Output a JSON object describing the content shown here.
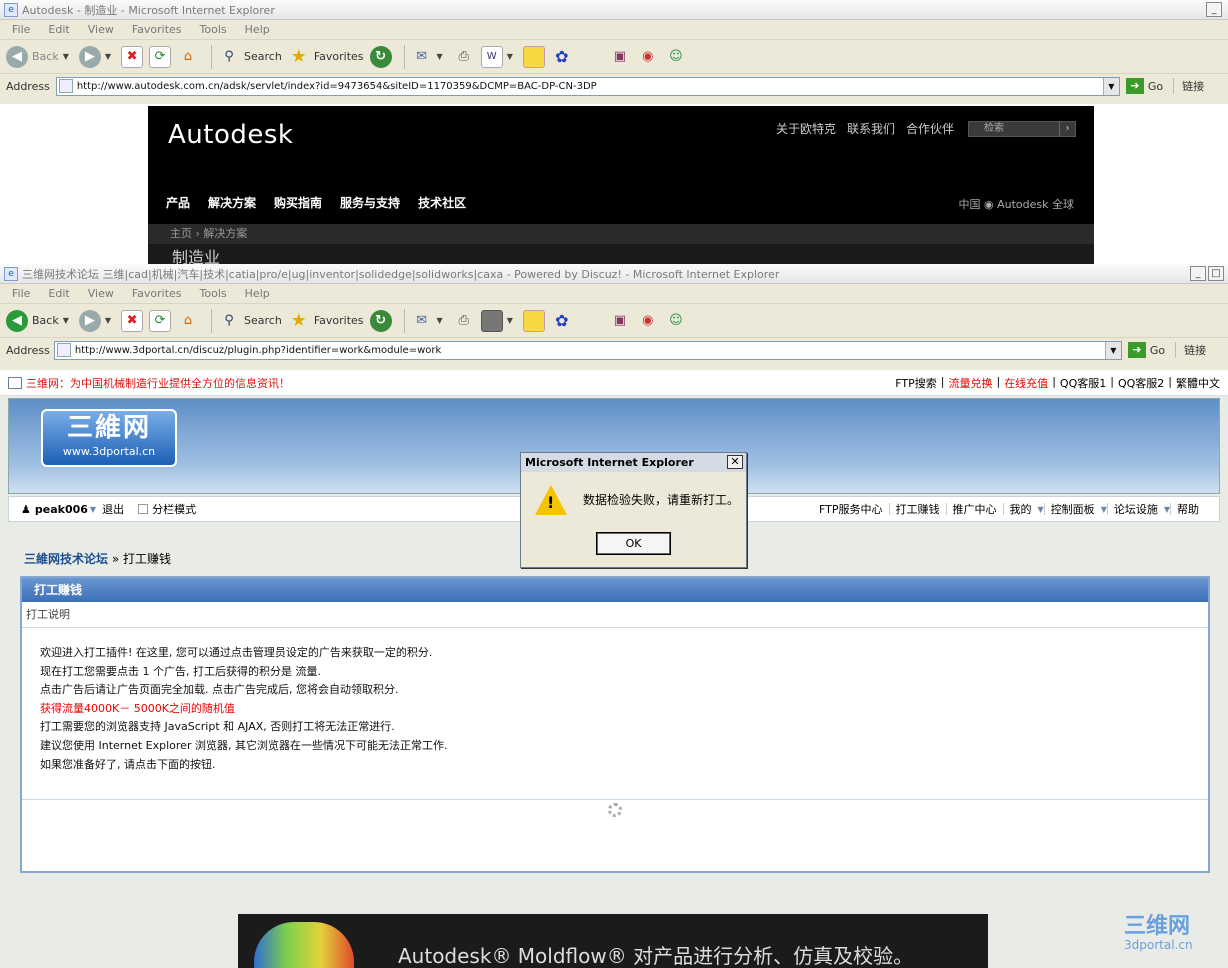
{
  "window1": {
    "title": "Autodesk - 制造业 - Microsoft Internet Explorer",
    "menu": [
      "File",
      "Edit",
      "View",
      "Favorites",
      "Tools",
      "Help"
    ],
    "toolbar": {
      "back": "Back",
      "search": "Search",
      "favorites": "Favorites"
    },
    "address_label": "Address",
    "url": "http://www.autodesk.com.cn/adsk/servlet/index?id=9473654&siteID=1170359&DCMP=BAC-DP-CN-3DP",
    "go": "Go",
    "links": "链接",
    "page": {
      "logo": "Autodesk",
      "top_links": [
        "关于欧特克",
        "联系我们",
        "合作伙伴"
      ],
      "search_placeholder": "检索",
      "nav": [
        "产品",
        "解决方案",
        "购买指南",
        "服务与支持",
        "技术社区"
      ],
      "region": "中国",
      "global": "Autodesk 全球",
      "breadcrumb": "主页 › 解决方案",
      "subtitle": "制造业"
    }
  },
  "window2": {
    "title": "三维网技术论坛 三维|cad|机械|汽车|技术|catia|pro/e|ug|inventor|solidedge|solidworks|caxa - Powered by Discuz! - Microsoft Internet Explorer",
    "menu": [
      "File",
      "Edit",
      "View",
      "Favorites",
      "Tools",
      "Help"
    ],
    "toolbar": {
      "back": "Back",
      "search": "Search",
      "favorites": "Favorites"
    },
    "address_label": "Address",
    "url": "http://www.3dportal.cn/discuz/plugin.php?identifier=work&module=work",
    "go": "Go",
    "links": "链接",
    "page": {
      "slogan": "三维网：为中国机械制造行业提供全方位的信息资讯！",
      "top_right": [
        "FTP搜索",
        "流量兑换",
        "在线充值",
        "QQ客服1",
        "QQ客服2",
        "繁體中文"
      ],
      "logo_cn": "三維网",
      "logo_url": "www.3dportal.cn",
      "user": "peak006",
      "logout": "退出",
      "split_mode": "分栏模式",
      "nav_right": [
        "FTP服务中心",
        "打工赚钱",
        "推广中心",
        "我的",
        "控制面板",
        "论坛设施",
        "帮助"
      ],
      "crumb_home": "三維网技术论坛",
      "crumb_current": "» 打工赚钱",
      "panel_title": "打工赚钱",
      "panel_sub": "打工说明",
      "lines": [
        "欢迎进入打工插件! 在这里, 您可以通过点击管理员设定的广告来获取一定的积分.",
        "现在打工您需要点击  1 个广告, 打工后获得的积分是  流量.",
        "点击广告后请让广告页面完全加载. 点击广告完成后, 您将会自动领取积分.",
        "获得流量4000K－ 5000K之间的随机值",
        "打工需要您的浏览器支持  JavaScript 和  AJAX, 否则打工将无法正常进行.",
        "建议您使用  Internet Explorer 浏览器, 其它浏览器在一些情况下可能无法正常工作.",
        "如果您准备好了, 请点击下面的按钮."
      ],
      "banner": "Autodesk® Moldflow® 对产品进行分析、仿真及校验。",
      "watermark": "三维网",
      "watermark_url": "3dportal.cn"
    }
  },
  "dialog": {
    "title": "Microsoft Internet Explorer",
    "message": "数据检验失败，请重新打工。",
    "ok": "OK"
  },
  "colors": {
    "accent": "#3c6fb8",
    "red": "#e00000",
    "warning": "#f4c400"
  }
}
